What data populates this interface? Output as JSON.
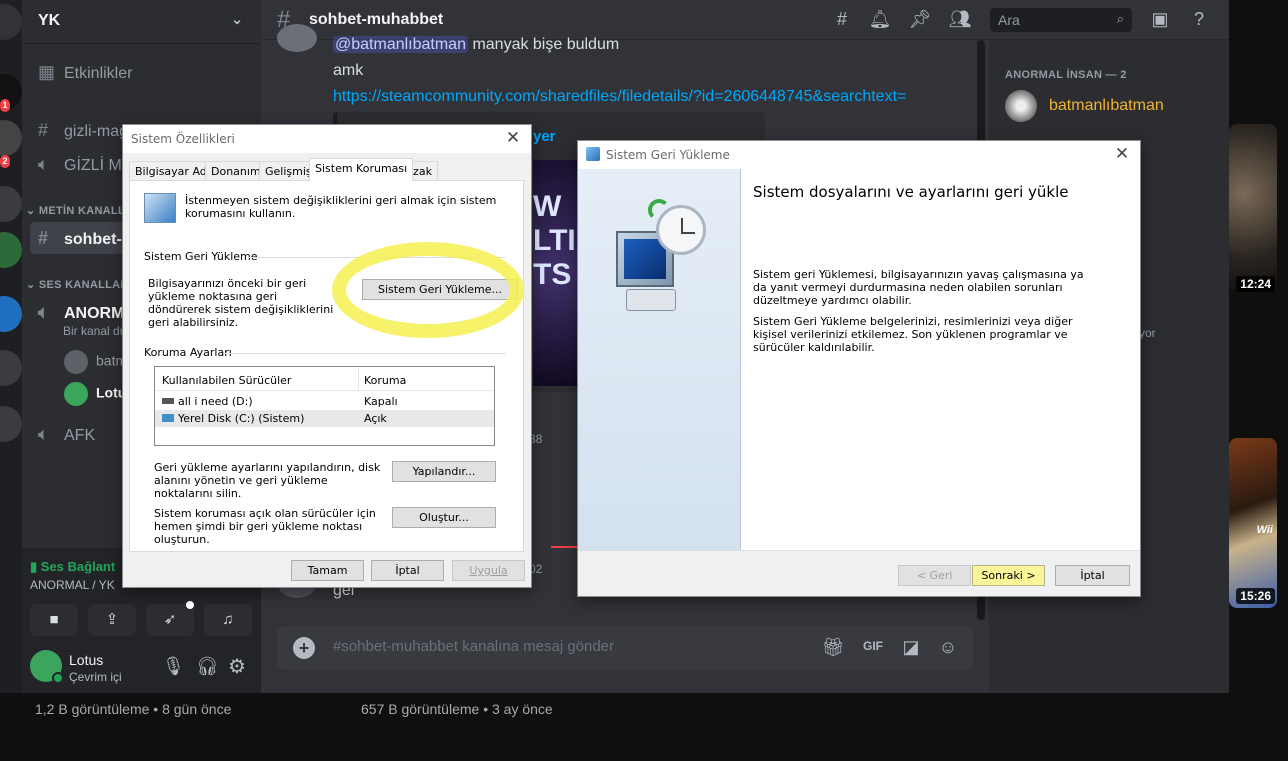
{
  "server": {
    "name": "YK"
  },
  "guild_badges": [
    "1",
    "2"
  ],
  "channels": {
    "events": "Etkinlikler",
    "text_1": "gizli-mag",
    "text_2": "GİZLİ MA",
    "category_text": "METİN KANALL",
    "active": "sohbet-m",
    "category_voice": "SES KANALLAR",
    "voice_1": "ANORMA",
    "voice_1_desc": "Bir kanal du",
    "voice_users": [
      "batm",
      "Lotu"
    ],
    "afk": "AFK"
  },
  "voice_panel": {
    "status": "Ses Bağlant",
    "channel": "ANORMAL / YK"
  },
  "user": {
    "name": "Lotus",
    "status": "Çevrim içi"
  },
  "chat": {
    "channel_name": "sohbet-muhabbet",
    "search_placeholder": "Ara",
    "mention": "@batmanlıbatman",
    "msg_tail": "manyak bişe buldum",
    "msg_amk": "amk",
    "link": "https://steamcommunity.com/sharedfiles/filedetails/?id=2606448745&searchtext=",
    "embed_title_frag": "yer",
    "embed_img_text": "W\nLTI\nTS 1.4",
    "ts_frag_1": "38",
    "ts_frag_2": "02",
    "msg_bottom": "gel",
    "composer_placeholder": "#sohbet-muhabbet kanalına mesaj gönder"
  },
  "members": {
    "category": "ANORMAL İNSAN — 2",
    "member_1": "batmanlıbatman",
    "fragment": "yor"
  },
  "youtube": {
    "dur_1": "12:24",
    "dur_2": "15:26",
    "wii": "Wii",
    "views_1": "1,2 B görüntüleme • 8 gün önce",
    "views_2": "657 B görüntüleme • 3 ay önce"
  },
  "sys_props": {
    "title": "Sistem Özellikleri",
    "tabs": [
      "Bilgisayar Adı",
      "Donanım",
      "Gelişmiş",
      "Sistem Koruması",
      "Uzak"
    ],
    "intro": "İstenmeyen sistem değişikliklerini geri almak için sistem korumasını kullanın.",
    "restore_group": "Sistem Geri Yükleme",
    "restore_desc": "Bilgisayarınızı önceki bir geri yükleme noktasına geri döndürerek sistem değişikliklerini geri alabilirsiniz.",
    "restore_btn": "Sistem Geri Yükleme...",
    "protect_group": "Koruma Ayarları",
    "col_drives": "Kullanılabilen Sürücüler",
    "col_protect": "Koruma",
    "drives": [
      {
        "name": "all i need (D:)",
        "state": "Kapalı"
      },
      {
        "name": "Yerel Disk (C:) (Sistem)",
        "state": "Açık"
      }
    ],
    "configure_desc": "Geri yükleme ayarlarını yapılandırın, disk alanını yönetin ve geri yükleme noktalarını silin.",
    "configure_btn": "Yapılandır...",
    "create_desc": "Sistem koruması açık olan sürücüler için hemen şimdi bir geri yükleme noktası oluşturun.",
    "create_btn": "Oluştur...",
    "ok": "Tamam",
    "cancel": "İptal",
    "apply": "Uygula"
  },
  "restore_wizard": {
    "title": "Sistem Geri Yükleme",
    "heading": "Sistem dosyalarını ve ayarlarını geri yükle",
    "para1": "Sistem geri Yüklemesi, bilgisayarınızın yavaş çalışmasına ya da yanıt vermeyi durdurmasına neden olabilen sorunları düzeltmeye yardımcı olabilir.",
    "para2": "Sistem Geri Yükleme belgelerinizi, resimlerinizi veya diğer kişisel verilerinizi etkilemez. Son yüklenen programlar ve sürücüler kaldırılabilir.",
    "back": "< Geri",
    "next": "Sonraki >",
    "cancel": "İptal"
  },
  "colors": {
    "accent_yellow": "#f5f050",
    "link": "#00a8fc",
    "member_gold": "#f0b232",
    "online": "#23a55a"
  }
}
